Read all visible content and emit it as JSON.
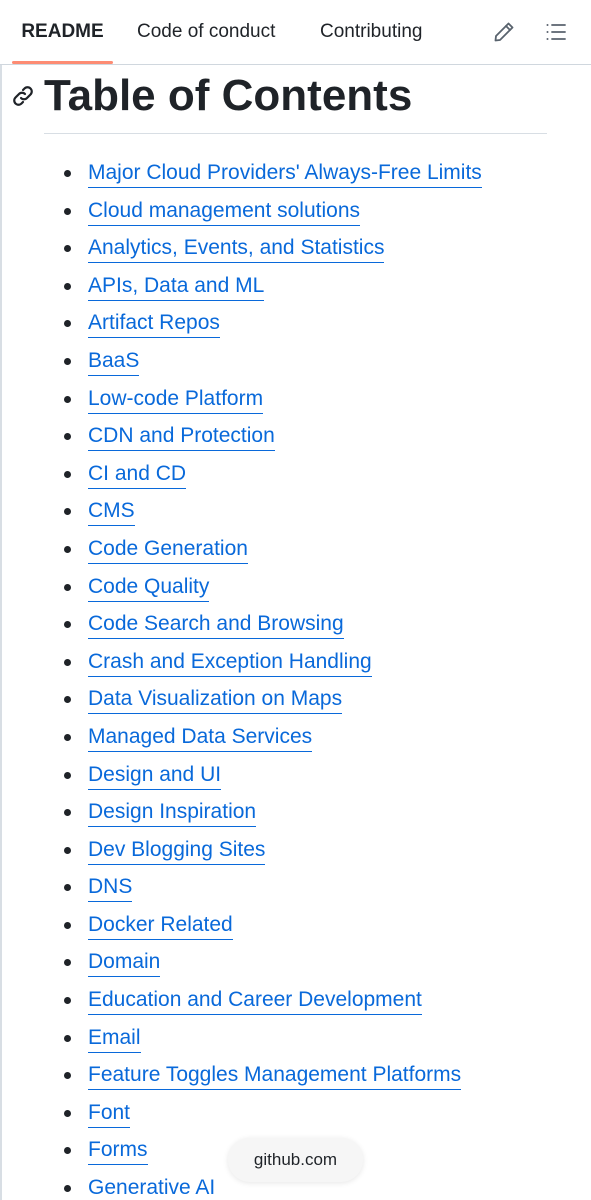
{
  "tabs": [
    {
      "label": "README",
      "active": true
    },
    {
      "label": "Code of conduct",
      "active": false
    },
    {
      "label": "Contributing",
      "active": false
    }
  ],
  "toolbar": {
    "edit_icon": "pencil-icon",
    "toc_icon": "list-unordered-icon"
  },
  "heading": {
    "title": "Table of Contents",
    "anchor_icon": "link-icon"
  },
  "toc": [
    "Major Cloud Providers' Always-Free Limits",
    "Cloud management solutions",
    "Analytics, Events, and Statistics",
    "APIs, Data and ML",
    "Artifact Repos",
    "BaaS",
    "Low-code Platform",
    "CDN and Protection",
    "CI and CD",
    "CMS",
    "Code Generation",
    "Code Quality",
    "Code Search and Browsing",
    "Crash and Exception Handling",
    "Data Visualization on Maps",
    "Managed Data Services",
    "Design and UI",
    "Design Inspiration",
    "Dev Blogging Sites",
    "DNS",
    "Docker Related",
    "Domain",
    "Education and Career Development",
    "Email",
    "Feature Toggles Management Platforms",
    "Font",
    "Forms",
    "Generative AI"
  ],
  "browser": {
    "url": "github.com"
  },
  "colors": {
    "link": "#0969da",
    "text": "#1f2328",
    "active_tab_underline": "#fd8c73",
    "divider": "#d8dee4"
  }
}
